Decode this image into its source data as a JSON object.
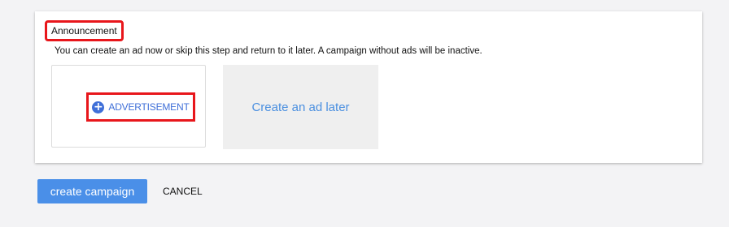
{
  "section": {
    "title": "Announcement",
    "description": "You can create an ad now or skip this step and return to it later. A campaign without ads will be inactive."
  },
  "options": {
    "add_ad_icon": "plus-circle-icon",
    "add_ad_label": "ADVERTISEMENT",
    "later_label": "Create an ad later"
  },
  "actions": {
    "create_label": "create campaign",
    "cancel_label": "CANCEL"
  },
  "colors": {
    "accent": "#4a8fe8",
    "highlight_border": "#e8161b",
    "link_blue": "#3f6fd8"
  }
}
